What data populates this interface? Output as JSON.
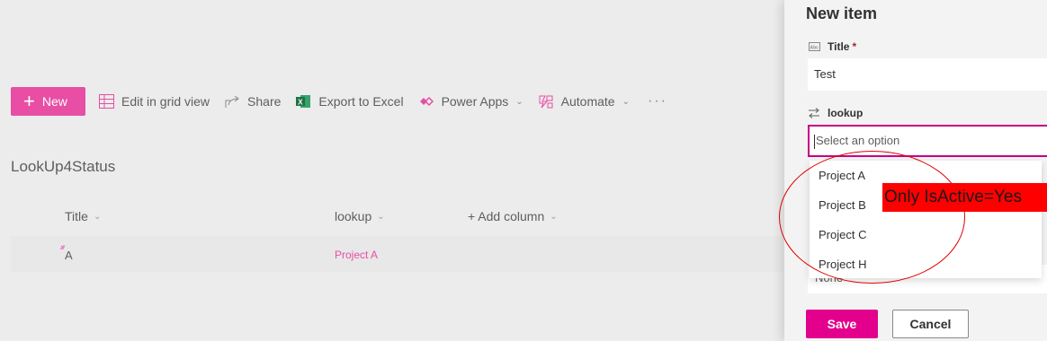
{
  "commandbar": {
    "new_label": "New",
    "edit_grid_label": "Edit in grid view",
    "share_label": "Share",
    "export_label": "Export to Excel",
    "powerapps_label": "Power Apps",
    "automate_label": "Automate",
    "more_label": "···"
  },
  "list": {
    "title": "LookUp4Status",
    "columns": {
      "title": "Title",
      "lookup": "lookup",
      "add_column": "+ Add column"
    },
    "rows": [
      {
        "title": "A",
        "lookup": "Project A"
      }
    ]
  },
  "panel": {
    "heading": "New item",
    "title_field": {
      "icon": "abc-text-icon",
      "label": "Title",
      "required_mark": "*",
      "value": "Test"
    },
    "lookup_field": {
      "icon": "switch-arrows-icon",
      "label": "lookup",
      "placeholder": "Select an option"
    },
    "options": [
      "Project A",
      "Project B",
      "Project C",
      "Project H"
    ],
    "underlying_value": "None",
    "save_label": "Save",
    "cancel_label": "Cancel"
  },
  "annotation": {
    "text": "Only IsActive=Yes"
  },
  "colors": {
    "accent": "#e74ea4",
    "save": "#e3008c",
    "annotation": "#ff0000"
  }
}
